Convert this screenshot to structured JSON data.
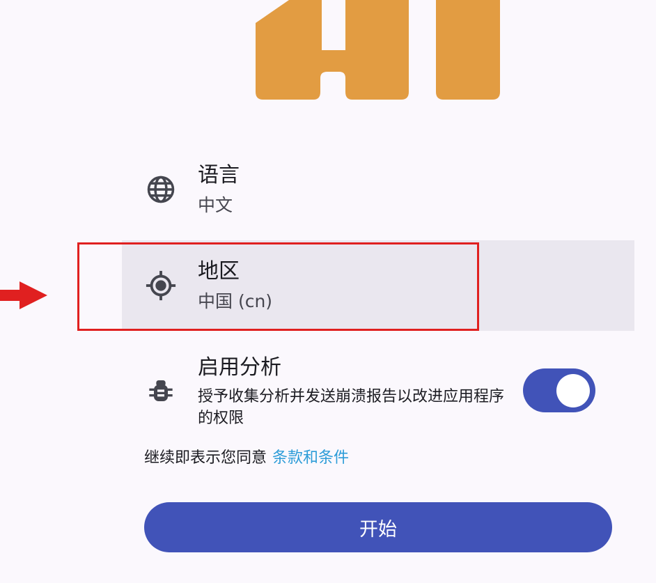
{
  "colors": {
    "background": "#FBF8FD",
    "logo": "#E29C42",
    "accent": "#4153B8",
    "link": "#2C9CD8",
    "selected_row": "#EAE7EF",
    "annotation": "#E02020"
  },
  "settings": {
    "language": {
      "icon": "globe-icon",
      "title": "语言",
      "value": "中文"
    },
    "region": {
      "icon": "gps-target-icon",
      "title": "地区",
      "value": "中国 (cn)"
    },
    "analytics": {
      "icon": "bug-icon",
      "title": "启用分析",
      "description": "授予收集分析并发送崩溃报告以改进应用程序的权限",
      "enabled": true
    }
  },
  "terms": {
    "prefix": "继续即表示您同意",
    "link": "条款和条件"
  },
  "start_button": {
    "label": "开始"
  },
  "annotation": {
    "arrow_icon": "red-arrow-icon"
  }
}
